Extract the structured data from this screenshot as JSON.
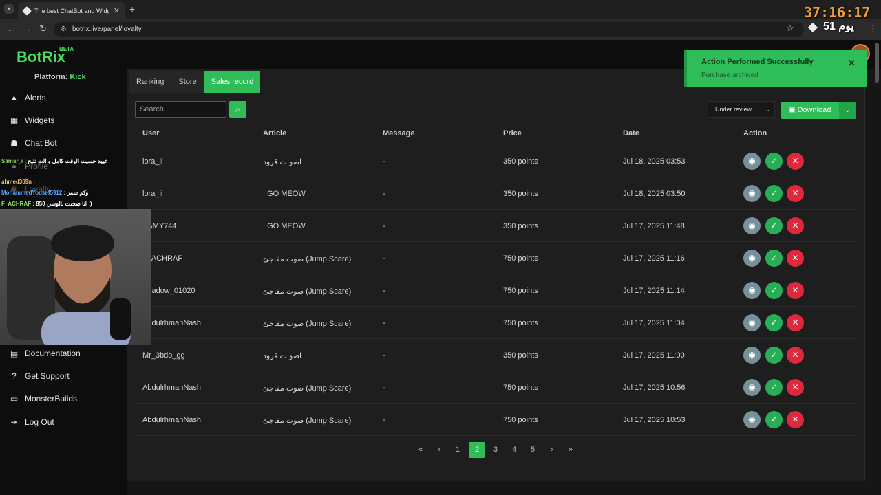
{
  "browser": {
    "tab_title": "The best ChatBot and Widgets",
    "url": "botrix.live/panel/loyalty"
  },
  "overlay": {
    "timer": "37:16:17",
    "day_badge": "يوم 51"
  },
  "brand": {
    "name": "BotRix",
    "beta": "BETA",
    "color": "#4ade5e"
  },
  "platform": {
    "label": "Platform:",
    "value": "Kick"
  },
  "sidebar": {
    "items": [
      {
        "label": "Alerts",
        "icon": "warning-icon"
      },
      {
        "label": "Widgets",
        "icon": "grid-icon"
      },
      {
        "label": "Chat Bot",
        "icon": "robot-icon"
      },
      {
        "label": "Profile",
        "icon": "user-icon"
      },
      {
        "label": "Loyalty",
        "icon": "coins-icon"
      },
      {
        "label": "Documentation",
        "icon": "book-icon"
      },
      {
        "label": "Get Support",
        "icon": "question-icon"
      },
      {
        "label": "MonsterBuilds",
        "icon": "laptop-icon"
      },
      {
        "label": "Log Out",
        "icon": "logout-icon"
      }
    ]
  },
  "tabs": [
    "Ranking",
    "Store",
    "Sales record"
  ],
  "search": {
    "placeholder": "Search..."
  },
  "filter": {
    "selected": "Under review"
  },
  "download": {
    "label": "Download"
  },
  "table": {
    "headers": [
      "User",
      "Article",
      "Message",
      "Price",
      "Date",
      "Action"
    ],
    "rows": [
      {
        "user": "lora_ii",
        "article": "اصوات قرود",
        "message": "-",
        "price": "350 points",
        "date": "Jul 18, 2025 03:53"
      },
      {
        "user": "lora_ii",
        "article": "I GO MEOW",
        "message": "-",
        "price": "350 points",
        "date": "Jul 18, 2025 03:50"
      },
      {
        "user": "SAMY744",
        "article": "I GO MEOW",
        "message": "-",
        "price": "350 points",
        "date": "Jul 17, 2025 11:48"
      },
      {
        "user": "F_ACHRAF",
        "article": "صوت مفاجئ (Jump Scare)",
        "message": "-",
        "price": "750 points",
        "date": "Jul 17, 2025 11:16"
      },
      {
        "user": "Shadow_01020",
        "article": "صوت مفاجئ (Jump Scare)",
        "message": "-",
        "price": "750 points",
        "date": "Jul 17, 2025 11:14"
      },
      {
        "user": "AbdulrhmanNash",
        "article": "صوت مفاجئ (Jump Scare)",
        "message": "-",
        "price": "750 points",
        "date": "Jul 17, 2025 11:04"
      },
      {
        "user": "Mr_3bdo_gg",
        "article": "اصوات قرود",
        "message": "-",
        "price": "350 points",
        "date": "Jul 17, 2025 11:00"
      },
      {
        "user": "AbdulrhmanNash",
        "article": "صوت مفاجئ (Jump Scare)",
        "message": "-",
        "price": "750 points",
        "date": "Jul 17, 2025 10:56"
      },
      {
        "user": "AbdulrhmanNash",
        "article": "صوت مفاجئ (Jump Scare)",
        "message": "-",
        "price": "750 points",
        "date": "Jul 17, 2025 10:53"
      }
    ]
  },
  "pagination": {
    "pages": [
      "1",
      "2",
      "3",
      "4",
      "5"
    ],
    "current": "2"
  },
  "toast": {
    "title": "Action Performed Successfully",
    "message": "Purchase archived"
  },
  "chat": [
    {
      "user": "Samar_i",
      "message": ": عيود حسيت الوقت كامل و الت تليح"
    },
    {
      "user": "ahmed369n",
      "message": ":"
    },
    {
      "user": "MohammedYousef5912",
      "message": ": وكم سمر"
    },
    {
      "user": "F_ACHRAF",
      "message": ": انا ضحيت بالوسي 850 :)"
    }
  ]
}
